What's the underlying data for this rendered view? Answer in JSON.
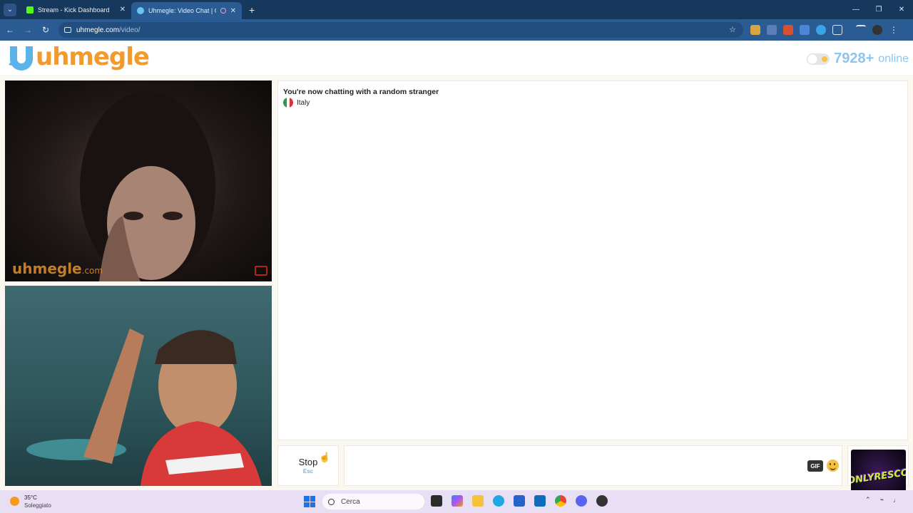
{
  "browser": {
    "tabs": [
      {
        "title": "Stream - Kick Dashboard",
        "favicon_color": "#53fc18"
      },
      {
        "title": "Uhmegle: Video Chat | Ome",
        "favicon_color": "#6cc3f0",
        "active": true
      }
    ],
    "new_tab": "+",
    "url_host": "uhmegle.com",
    "url_path": "/video/"
  },
  "site": {
    "logo_text": "uhmegle",
    "online_count": "7928+",
    "online_label": "online",
    "brand_orange": "#f39a2c",
    "brand_blue": "#8cc6ec"
  },
  "videos": {
    "stranger_watermark": "uhmegle",
    "stranger_watermark_suffix": ".com"
  },
  "chat": {
    "status": "You're now chatting with a random stranger",
    "country": "Italy"
  },
  "controls": {
    "stop_label": "Stop",
    "stop_key": "Esc",
    "gif_label": "GIF"
  },
  "overlay": {
    "logo_text": "ONLYRESCO"
  },
  "taskbar": {
    "weather_temp": "35°C",
    "weather_desc": "Soleggiato",
    "search_placeholder": "Cerca"
  }
}
